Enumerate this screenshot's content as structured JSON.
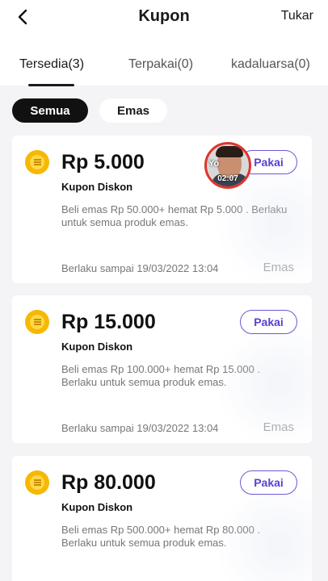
{
  "header": {
    "title": "Kupon",
    "action": "Tukar",
    "back_icon": "chevron-left-icon"
  },
  "tabs": [
    {
      "label": "Tersedia(3)",
      "active": true
    },
    {
      "label": "Terpakai(0)",
      "active": false
    },
    {
      "label": "kadaluarsa(0)",
      "active": false
    }
  ],
  "filters": [
    {
      "label": "Semua",
      "active": true
    },
    {
      "label": "Emas",
      "active": false
    }
  ],
  "coupons": [
    {
      "amount": "Rp 5.000",
      "type": "Kupon Diskon",
      "desc": "Beli emas Rp 50.000+ hemat Rp 5.000 . Berlaku untuk semua produk emas.",
      "valid": "Berlaku sampai 19/03/2022 13:04",
      "category": "Emas",
      "button": "Pakai"
    },
    {
      "amount": "Rp 15.000",
      "type": "Kupon Diskon",
      "desc": "Beli emas Rp 100.000+ hemat Rp 15.000 . Berlaku untuk semua produk emas.",
      "valid": "Berlaku sampai 19/03/2022 13:04",
      "category": "Emas",
      "button": "Pakai"
    },
    {
      "amount": "Rp 80.000",
      "type": "Kupon Diskon",
      "desc": "Beli emas Rp 500.000+ hemat Rp 80.000 . Berlaku untuk semua produk emas.",
      "valid": "",
      "category": "",
      "button": "Pakai"
    }
  ],
  "video_overlay": {
    "time": "02:07",
    "logo": "Yo"
  },
  "colors": {
    "accent": "#5a3fd0",
    "coin": "#f6b800",
    "active_chip": "#111111"
  }
}
